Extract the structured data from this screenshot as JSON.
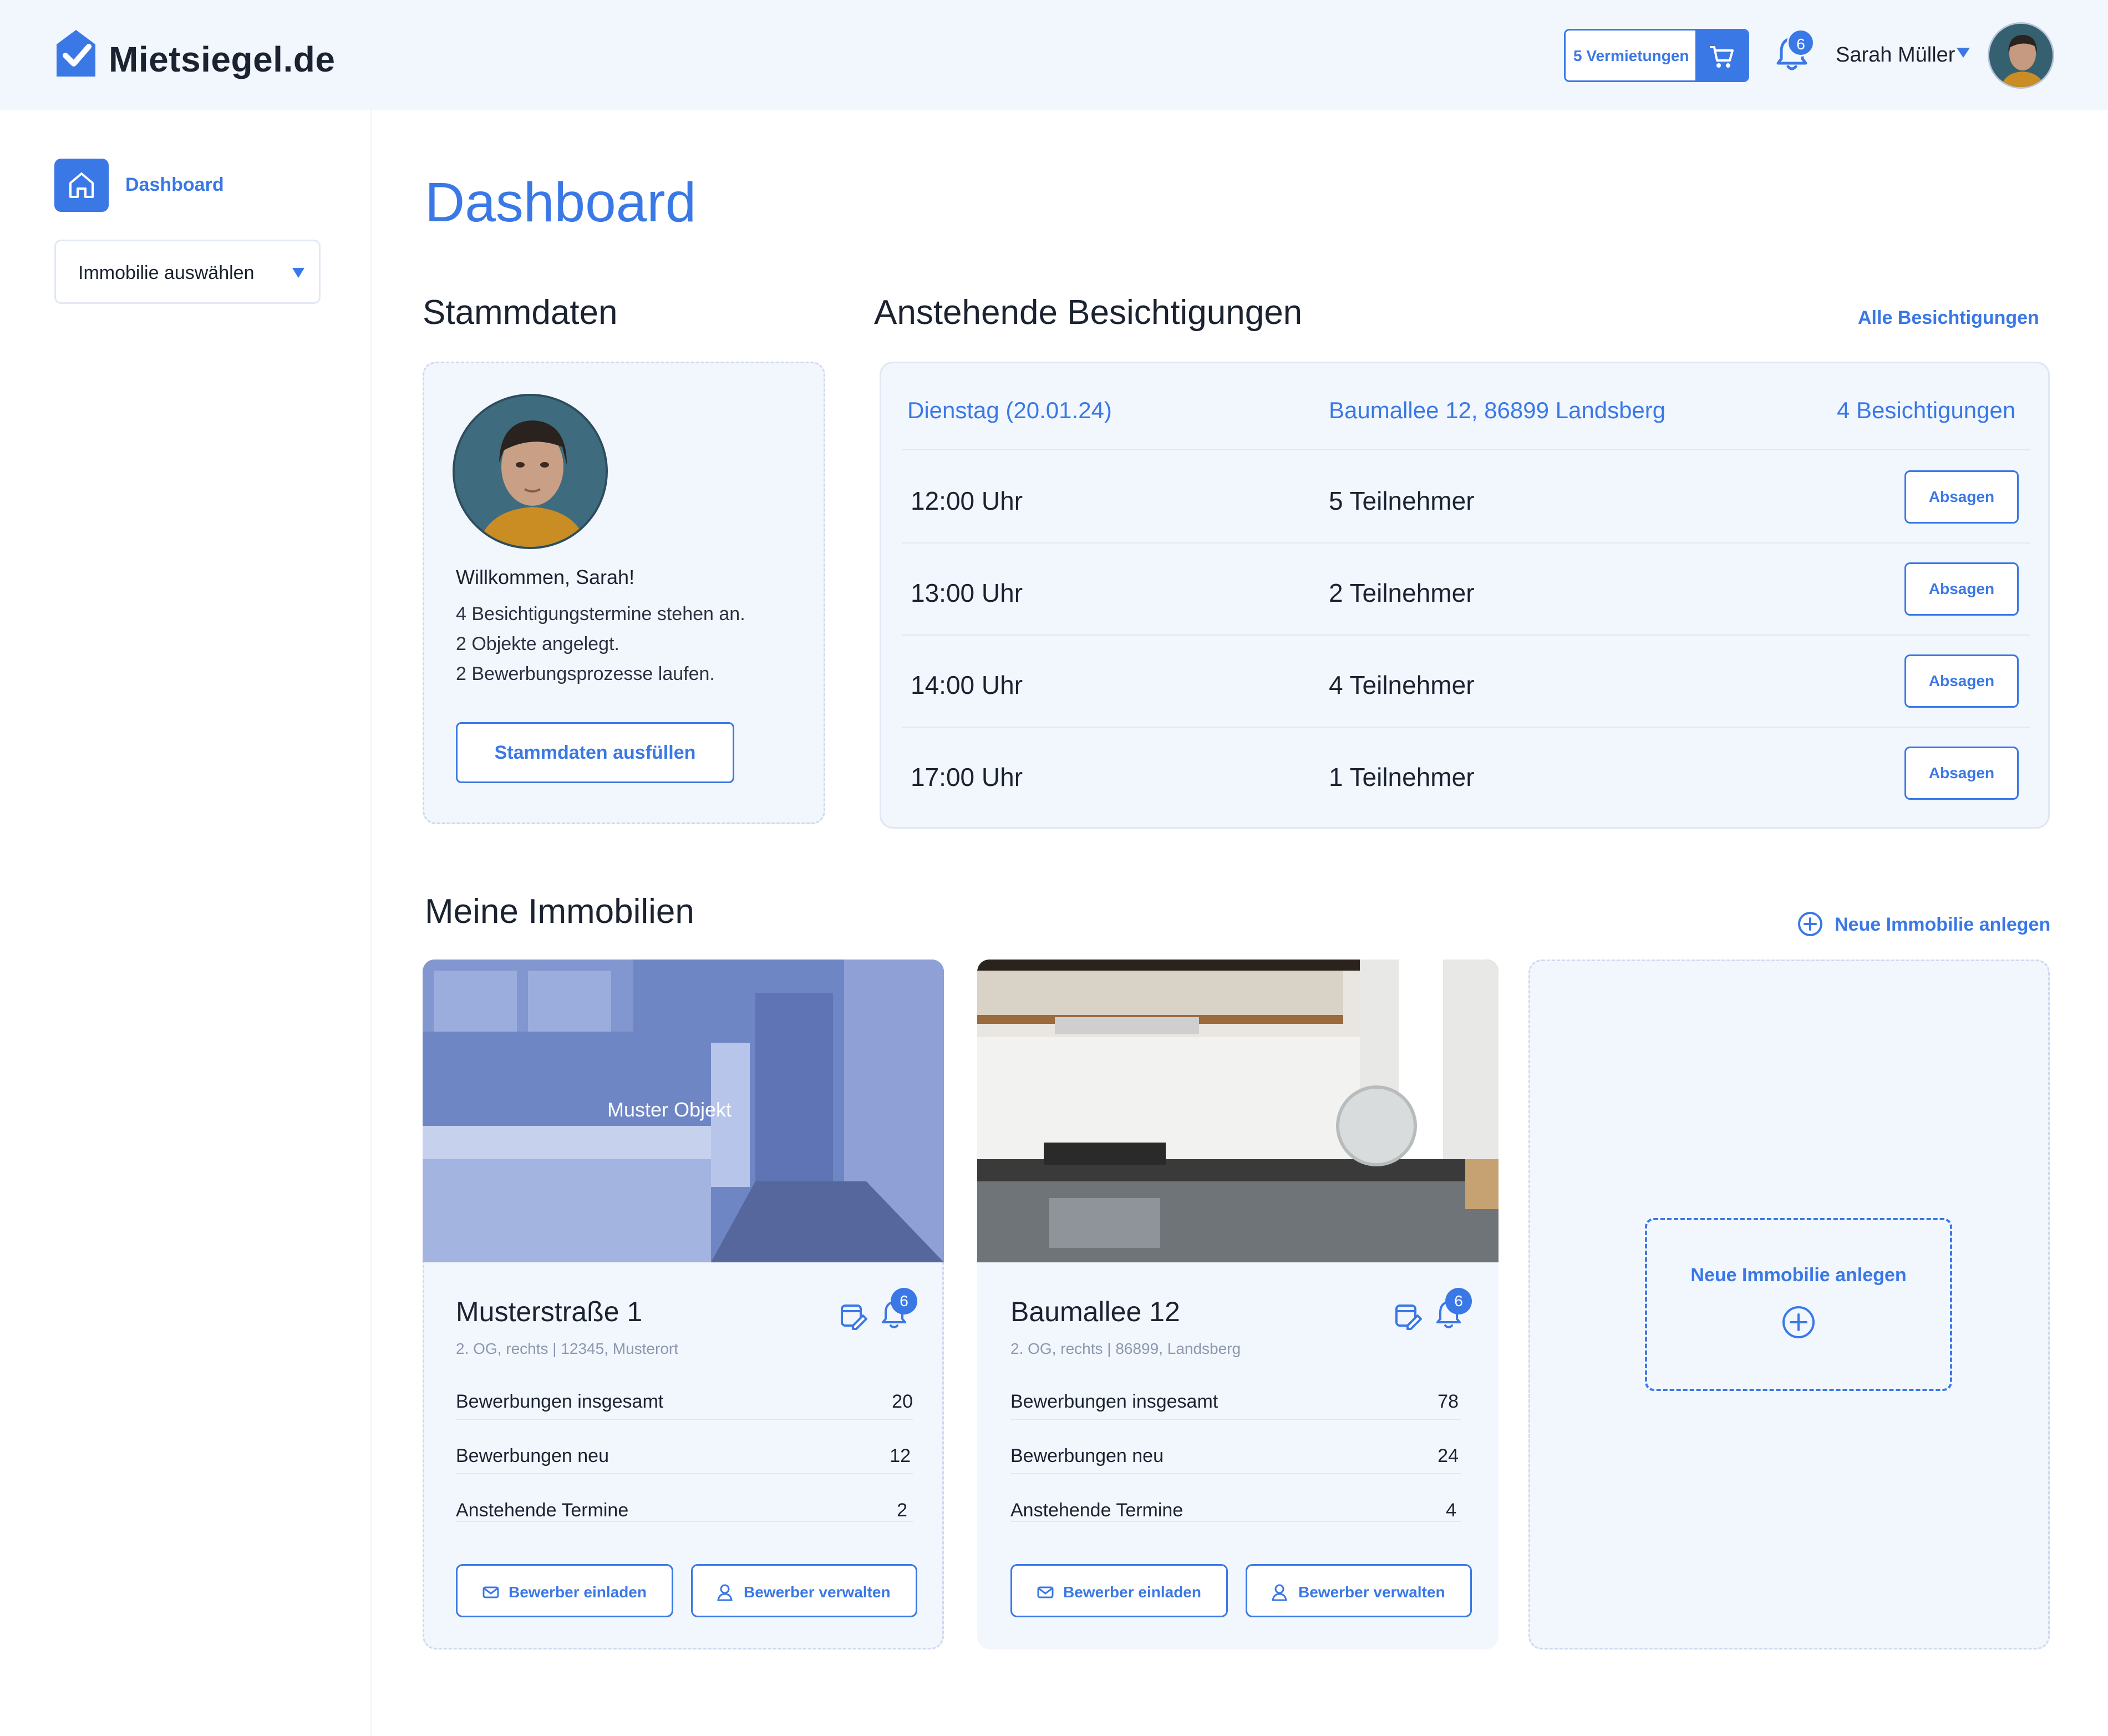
{
  "app": {
    "logo_text": "Mietsiegel.de",
    "accent_color": "#3a78e6",
    "background_color": "#f2f6fd"
  },
  "header": {
    "cart_label": "5 Vermietungen",
    "cart_icon": "cart-icon",
    "notification_count": "6",
    "user_name": "Sarah Müller"
  },
  "sidebar": {
    "dashboard_label": "Dashboard",
    "property_select": "Immobilie auswählen"
  },
  "main": {
    "title": "Dashboard",
    "stammdaten": {
      "heading": "Stammdaten",
      "welcome": "Willkommen, Sarah!",
      "stats": [
        "4 Besichtigungstermine stehen an.",
        "2 Objekte angelegt.",
        "2 Bewerbungsprozesse laufen."
      ],
      "button": "Stammdaten ausfüllen"
    },
    "besichtigungen": {
      "heading": "Anstehende Besichtigungen",
      "all_link": "Alle Besichtigungen",
      "header_day": "Dienstag (20.01.24)",
      "header_address": "Baumallee 12, 86899 Landsberg",
      "header_count": "4 Besichtigungen",
      "rows": [
        {
          "time": "12:00 Uhr",
          "participants": "5 Teilnehmer",
          "action": "Absagen"
        },
        {
          "time": "13:00 Uhr",
          "participants": "2 Teilnehmer",
          "action": "Absagen"
        },
        {
          "time": "14:00 Uhr",
          "participants": "4 Teilnehmer",
          "action": "Absagen"
        },
        {
          "time": "17:00 Uhr",
          "participants": "1 Teilnehmer",
          "action": "Absagen"
        }
      ]
    },
    "immobilien": {
      "heading": "Meine Immobilien",
      "new_link": "Neue Immobilie anlegen",
      "new_box_label": "Neue Immobilie anlegen",
      "properties": [
        {
          "image_overlay": "Muster Objekt",
          "title": "Musterstraße 1",
          "subtitle": "2. OG, rechts | 12345, Musterort",
          "badge": "6",
          "stats": [
            {
              "label": "Bewerbungen insgesamt",
              "value": "20"
            },
            {
              "label": "Bewerbungen neu",
              "value": "12"
            },
            {
              "label": "Anstehende Termine",
              "value": "2"
            }
          ],
          "invite_button": "Bewerber einladen",
          "manage_button": "Bewerber verwalten"
        },
        {
          "title": "Baumallee 12",
          "subtitle": "2. OG, rechts | 86899, Landsberg",
          "badge": "6",
          "stats": [
            {
              "label": "Bewerbungen insgesamt",
              "value": "78"
            },
            {
              "label": "Bewerbungen neu",
              "value": "24"
            },
            {
              "label": "Anstehende Termine",
              "value": "4"
            }
          ],
          "invite_button": "Bewerber einladen",
          "manage_button": "Bewerber verwalten"
        }
      ]
    }
  }
}
